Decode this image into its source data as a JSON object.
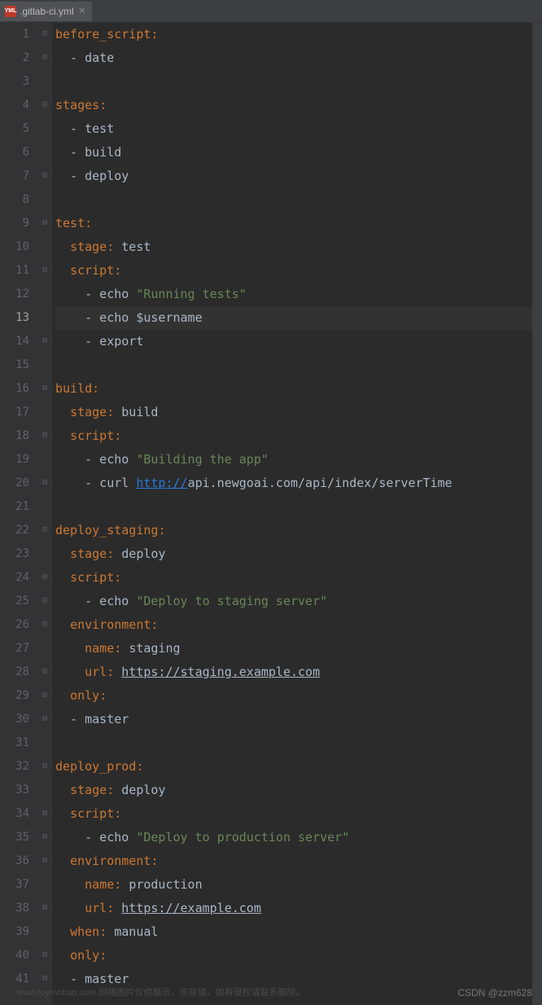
{
  "tab": {
    "icon_label": "YML",
    "filename": ".gitlab-ci.yml"
  },
  "current_line": 13,
  "lines": [
    {
      "n": 1,
      "fold": "open",
      "tokens": [
        {
          "t": "key",
          "v": "before_script"
        },
        {
          "t": "colon",
          "v": ":"
        }
      ]
    },
    {
      "n": 2,
      "fold": "close",
      "tokens": [
        {
          "t": "plain",
          "v": "  - date"
        }
      ]
    },
    {
      "n": 3,
      "tokens": []
    },
    {
      "n": 4,
      "fold": "open",
      "tokens": [
        {
          "t": "key",
          "v": "stages"
        },
        {
          "t": "colon",
          "v": ":"
        }
      ]
    },
    {
      "n": 5,
      "tokens": [
        {
          "t": "plain",
          "v": "  - test"
        }
      ]
    },
    {
      "n": 6,
      "tokens": [
        {
          "t": "plain",
          "v": "  - build"
        }
      ]
    },
    {
      "n": 7,
      "fold": "close",
      "tokens": [
        {
          "t": "plain",
          "v": "  - deploy"
        }
      ]
    },
    {
      "n": 8,
      "tokens": []
    },
    {
      "n": 9,
      "fold": "open",
      "tokens": [
        {
          "t": "key",
          "v": "test"
        },
        {
          "t": "colon",
          "v": ":"
        }
      ]
    },
    {
      "n": 10,
      "tokens": [
        {
          "t": "plain",
          "v": "  "
        },
        {
          "t": "key",
          "v": "stage"
        },
        {
          "t": "colon",
          "v": ": "
        },
        {
          "t": "plain",
          "v": "test"
        }
      ]
    },
    {
      "n": 11,
      "fold": "open",
      "tokens": [
        {
          "t": "plain",
          "v": "  "
        },
        {
          "t": "key",
          "v": "script"
        },
        {
          "t": "colon",
          "v": ":"
        }
      ]
    },
    {
      "n": 12,
      "tokens": [
        {
          "t": "plain",
          "v": "    - echo "
        },
        {
          "t": "string",
          "v": "\"Running tests\""
        }
      ]
    },
    {
      "n": 13,
      "tokens": [
        {
          "t": "plain",
          "v": "    - echo $username"
        }
      ]
    },
    {
      "n": 14,
      "fold": "close",
      "tokens": [
        {
          "t": "plain",
          "v": "    - export"
        }
      ]
    },
    {
      "n": 15,
      "tokens": []
    },
    {
      "n": 16,
      "fold": "open",
      "tokens": [
        {
          "t": "key",
          "v": "build"
        },
        {
          "t": "colon",
          "v": ":"
        }
      ]
    },
    {
      "n": 17,
      "tokens": [
        {
          "t": "plain",
          "v": "  "
        },
        {
          "t": "key",
          "v": "stage"
        },
        {
          "t": "colon",
          "v": ": "
        },
        {
          "t": "plain",
          "v": "build"
        }
      ]
    },
    {
      "n": 18,
      "fold": "open",
      "tokens": [
        {
          "t": "plain",
          "v": "  "
        },
        {
          "t": "key",
          "v": "script"
        },
        {
          "t": "colon",
          "v": ":"
        }
      ]
    },
    {
      "n": 19,
      "tokens": [
        {
          "t": "plain",
          "v": "    - echo "
        },
        {
          "t": "string",
          "v": "\"Building the app\""
        }
      ]
    },
    {
      "n": 20,
      "fold": "close",
      "tokens": [
        {
          "t": "plain",
          "v": "    - curl "
        },
        {
          "t": "link",
          "v": "http://"
        },
        {
          "t": "plain",
          "v": "api.newgoai.com/api/index/serverTime"
        }
      ]
    },
    {
      "n": 21,
      "tokens": []
    },
    {
      "n": 22,
      "fold": "open",
      "tokens": [
        {
          "t": "key",
          "v": "deploy_staging"
        },
        {
          "t": "colon",
          "v": ":"
        }
      ]
    },
    {
      "n": 23,
      "tokens": [
        {
          "t": "plain",
          "v": "  "
        },
        {
          "t": "key",
          "v": "stage"
        },
        {
          "t": "colon",
          "v": ": "
        },
        {
          "t": "plain",
          "v": "deploy"
        }
      ]
    },
    {
      "n": 24,
      "fold": "open",
      "tokens": [
        {
          "t": "plain",
          "v": "  "
        },
        {
          "t": "key",
          "v": "script"
        },
        {
          "t": "colon",
          "v": ":"
        }
      ]
    },
    {
      "n": 25,
      "fold": "close",
      "tokens": [
        {
          "t": "plain",
          "v": "    - echo "
        },
        {
          "t": "string",
          "v": "\"Deploy to staging server\""
        }
      ]
    },
    {
      "n": 26,
      "fold": "open",
      "tokens": [
        {
          "t": "plain",
          "v": "  "
        },
        {
          "t": "key",
          "v": "environment"
        },
        {
          "t": "colon",
          "v": ":"
        }
      ]
    },
    {
      "n": 27,
      "tokens": [
        {
          "t": "plain",
          "v": "    "
        },
        {
          "t": "key",
          "v": "name"
        },
        {
          "t": "colon",
          "v": ": "
        },
        {
          "t": "plain",
          "v": "staging"
        }
      ]
    },
    {
      "n": 28,
      "fold": "close",
      "tokens": [
        {
          "t": "plain",
          "v": "    "
        },
        {
          "t": "key",
          "v": "url"
        },
        {
          "t": "colon",
          "v": ": "
        },
        {
          "t": "link-plain",
          "v": "https://staging.example.com"
        }
      ]
    },
    {
      "n": 29,
      "fold": "open",
      "tokens": [
        {
          "t": "plain",
          "v": "  "
        },
        {
          "t": "key",
          "v": "only"
        },
        {
          "t": "colon",
          "v": ":"
        }
      ]
    },
    {
      "n": 30,
      "fold": "close",
      "tokens": [
        {
          "t": "plain",
          "v": "  - master"
        }
      ]
    },
    {
      "n": 31,
      "tokens": []
    },
    {
      "n": 32,
      "fold": "open",
      "tokens": [
        {
          "t": "key",
          "v": "deploy_prod"
        },
        {
          "t": "colon",
          "v": ":"
        }
      ]
    },
    {
      "n": 33,
      "tokens": [
        {
          "t": "plain",
          "v": "  "
        },
        {
          "t": "key",
          "v": "stage"
        },
        {
          "t": "colon",
          "v": ": "
        },
        {
          "t": "plain",
          "v": "deploy"
        }
      ]
    },
    {
      "n": 34,
      "fold": "open",
      "tokens": [
        {
          "t": "plain",
          "v": "  "
        },
        {
          "t": "key",
          "v": "script"
        },
        {
          "t": "colon",
          "v": ":"
        }
      ]
    },
    {
      "n": 35,
      "fold": "close",
      "tokens": [
        {
          "t": "plain",
          "v": "    - echo "
        },
        {
          "t": "string",
          "v": "\"Deploy to production server\""
        }
      ]
    },
    {
      "n": 36,
      "fold": "open",
      "tokens": [
        {
          "t": "plain",
          "v": "  "
        },
        {
          "t": "key",
          "v": "environment"
        },
        {
          "t": "colon",
          "v": ":"
        }
      ]
    },
    {
      "n": 37,
      "tokens": [
        {
          "t": "plain",
          "v": "    "
        },
        {
          "t": "key",
          "v": "name"
        },
        {
          "t": "colon",
          "v": ": "
        },
        {
          "t": "plain",
          "v": "production"
        }
      ]
    },
    {
      "n": 38,
      "fold": "close",
      "tokens": [
        {
          "t": "plain",
          "v": "    "
        },
        {
          "t": "key",
          "v": "url"
        },
        {
          "t": "colon",
          "v": ": "
        },
        {
          "t": "link-plain",
          "v": "https://example.com"
        }
      ]
    },
    {
      "n": 39,
      "tokens": [
        {
          "t": "plain",
          "v": "  "
        },
        {
          "t": "key",
          "v": "when"
        },
        {
          "t": "colon",
          "v": ": "
        },
        {
          "t": "plain",
          "v": "manual"
        }
      ]
    },
    {
      "n": 40,
      "fold": "open",
      "tokens": [
        {
          "t": "plain",
          "v": "  "
        },
        {
          "t": "key",
          "v": "only"
        },
        {
          "t": "colon",
          "v": ":"
        }
      ]
    },
    {
      "n": 41,
      "fold": "close",
      "tokens": [
        {
          "t": "plain",
          "v": "  - master"
        }
      ]
    }
  ],
  "watermark": "CSDN @zzm628",
  "watermark2": "www.toymoban.com 网络图片仅供展示，非存储，如有侵权请联系删除。"
}
